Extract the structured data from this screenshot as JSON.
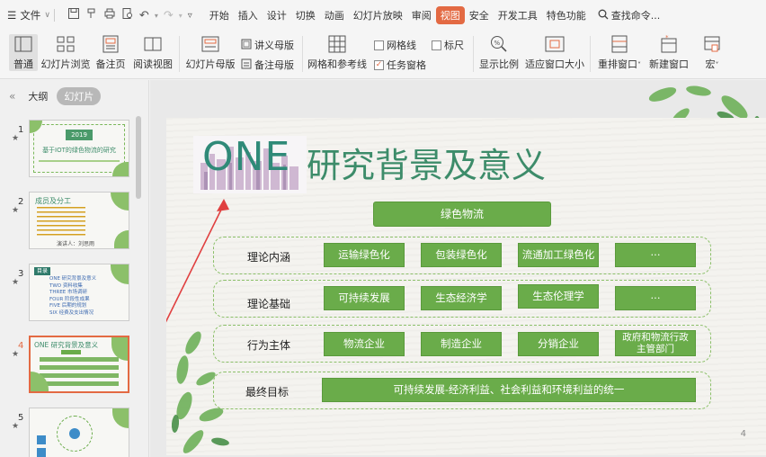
{
  "menubar": {
    "file_label": "文件",
    "tabs": [
      "开始",
      "插入",
      "设计",
      "切换",
      "动画",
      "幻灯片放映",
      "审阅",
      "视图",
      "安全",
      "开发工具",
      "特色功能"
    ],
    "active_tab": "视图",
    "search_label": "查找命令..."
  },
  "ribbon": {
    "normal": "普通",
    "slide_sorter": "幻灯片浏览",
    "notes_page": "备注页",
    "reading_view": "阅读视图",
    "slide_master": "幻灯片母版",
    "handout_master": "讲义母版",
    "notes_master": "备注母版",
    "grid_guides": "网格和参考线",
    "gridlines": "网格线",
    "ruler": "标尺",
    "task_pane": "任务窗格",
    "zoom": "显示比例",
    "fit_window": "适应窗口大小",
    "arrange_windows": "重排窗口",
    "new_window": "新建窗口",
    "macros": "宏"
  },
  "left_panel": {
    "tab_outline": "大纲",
    "tab_slides": "幻灯片",
    "thumbs": [
      {
        "num": "1",
        "text": "2019",
        "sub": "基于IOT的绿色物流的研究"
      },
      {
        "num": "2",
        "text": "成员及分工",
        "sub": "演讲人：刘思雨"
      },
      {
        "num": "3",
        "text": "目录",
        "items": [
          "ONE  研究背景及意义",
          "TWO  资料收集",
          "THREE  市场调研",
          "FOUR  阶段性成果",
          "FIVE  后期的规划",
          "SIX  经费及支出情况"
        ]
      },
      {
        "num": "4",
        "text": "ONE  研究背景及意义"
      },
      {
        "num": "5",
        "text": ""
      }
    ],
    "active_index": 3
  },
  "slide": {
    "title_prefix": "ONE",
    "title": "研究背景及意义",
    "top_box": "绿色物流",
    "rows": [
      {
        "label": "理论内涵",
        "items": [
          "运输绿色化",
          "包装绿色化",
          "流通加工绿色化",
          "···"
        ]
      },
      {
        "label": "理论基础",
        "items": [
          "可持续发展",
          "生态经济学",
          "生态伦理学",
          "···"
        ]
      },
      {
        "label": "行为主体",
        "items": [
          "物流企业",
          "制造企业",
          "分销企业",
          "政府和物流行政主管部门"
        ]
      },
      {
        "label": "最终目标",
        "items": [
          "可持续发展-经济利益、社会利益和环境利益的统一"
        ]
      }
    ],
    "page_number": "4"
  },
  "colors": {
    "accent": "#e36a43",
    "green_box": "#6aac4a",
    "title_green": "#3d8c6a"
  }
}
